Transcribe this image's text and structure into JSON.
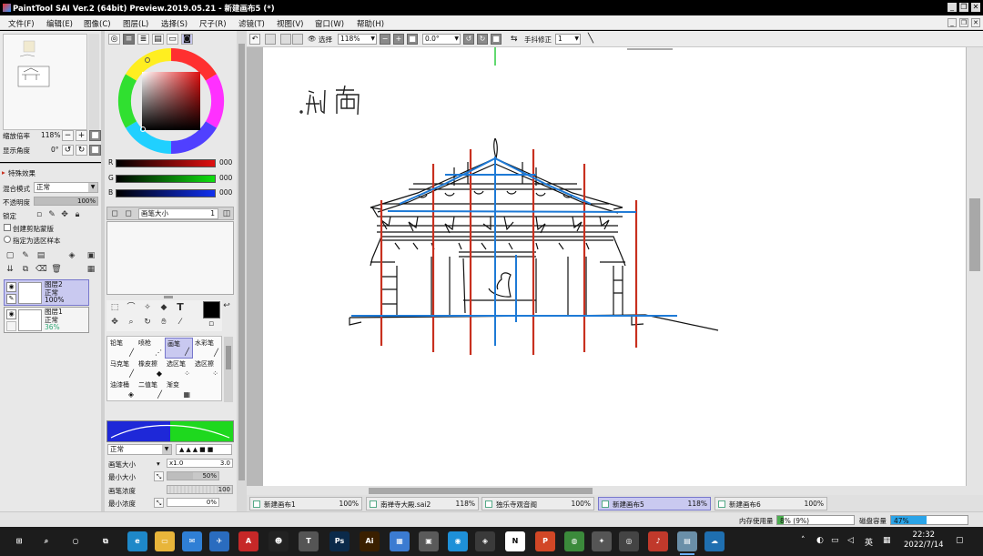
{
  "window": {
    "title": "PaintTool SAI Ver.2 (64bit) Preview.2019.05.21 - 新建画布5 (*)",
    "controls": {
      "minimize": "_",
      "restore": "❐",
      "close": "✕"
    }
  },
  "menu": [
    "文件(F)",
    "编辑(E)",
    "图像(C)",
    "图层(L)",
    "选择(S)",
    "尺子(R)",
    "滤镜(T)",
    "视图(V)",
    "窗口(W)",
    "帮助(H)"
  ],
  "navigator": {
    "zoom_label": "缩放倍率",
    "zoom_value": "118%",
    "angle_label": "显示角度",
    "angle_value": "0°"
  },
  "layer_panel": {
    "effects_label": "特殊效果",
    "blend_label": "混合模式",
    "blend_value": "正常",
    "opacity_label": "不透明度",
    "opacity_value": "100%",
    "opacity_fraction": 1.0,
    "lock_label": "锁定",
    "clip_label": "创建剪贴蒙版",
    "sample_label": "指定为选区样本",
    "layers": [
      {
        "name": "图层2",
        "mode": "正常",
        "opacity": "100%",
        "selected": true
      },
      {
        "name": "图层1",
        "mode": "正常",
        "opacity": "36%",
        "selected": false
      }
    ]
  },
  "color_panel": {
    "r_label": "R",
    "r_value": "000",
    "g_label": "G",
    "g_value": "000",
    "b_label": "B",
    "b_value": "000",
    "brush_size_label": "画笔大小",
    "brush_size_value": "1"
  },
  "brushes": [
    {
      "label": "铅笔",
      "icon": "pencil-icon",
      "selected": false
    },
    {
      "label": "喷枪",
      "icon": "airbrush-icon",
      "selected": false
    },
    {
      "label": "画笔",
      "icon": "brush-icon",
      "selected": true
    },
    {
      "label": "水彩笔",
      "icon": "watercolor-icon",
      "selected": false
    },
    {
      "label": "马克笔",
      "icon": "marker-icon",
      "selected": false
    },
    {
      "label": "橡皮擦",
      "icon": "eraser-icon",
      "selected": false
    },
    {
      "label": "选区笔",
      "icon": "select-pen-icon",
      "selected": false
    },
    {
      "label": "选区擦",
      "icon": "select-eraser-icon",
      "selected": false
    },
    {
      "label": "油漆桶",
      "icon": "bucket-icon",
      "selected": false
    },
    {
      "label": "二值笔",
      "icon": "binary-pen-icon",
      "selected": false
    },
    {
      "label": "渐变",
      "icon": "gradient-icon",
      "selected": false
    },
    {
      "label": "",
      "icon": "",
      "selected": false
    }
  ],
  "brush_settings": {
    "mode_value": "正常",
    "size_label": "画笔大小",
    "size_mult": "x1.0",
    "size_value": "3.0",
    "min_size_label": "最小大小",
    "min_size_value": "50%",
    "min_size_fraction": 0.5,
    "density_label": "画笔浓度",
    "density_value": "100",
    "density_fraction": 1.0,
    "min_density_label": "最小浓度",
    "min_density_value": "0%",
    "min_density_fraction": 0.0
  },
  "canvas_toolbar": {
    "select_label": "选择",
    "zoom_value": "118%",
    "angle_value": "0.0°",
    "stabilizer_label": "手抖修正",
    "stabilizer_value": "1"
  },
  "documents": [
    {
      "name": "新建画布1",
      "zoom": "100%",
      "selected": false
    },
    {
      "name": "南禅寺大殿.sai2",
      "zoom": "118%",
      "selected": false
    },
    {
      "name": "独乐寺观音阁",
      "zoom": "100%",
      "selected": false
    },
    {
      "name": "新建画布5",
      "zoom": "118%",
      "selected": true
    },
    {
      "name": "新建画布6",
      "zoom": "100%",
      "selected": false
    }
  ],
  "status": {
    "memory_label": "内存使用量",
    "memory_value": "8% (9%)",
    "memory_fraction": 0.08,
    "disk_label": "磁盘容量",
    "disk_value": "47%",
    "disk_fraction": 0.47
  },
  "taskbar": {
    "apps": [
      {
        "name": "start-icon",
        "glyph": "⊞",
        "color": "#1c1c1c"
      },
      {
        "name": "search-icon",
        "glyph": "⌕",
        "color": "#1c1c1c"
      },
      {
        "name": "cortana-icon",
        "glyph": "○",
        "color": "#1c1c1c"
      },
      {
        "name": "task-view-icon",
        "glyph": "⧉",
        "color": "#1c1c1c"
      },
      {
        "name": "edge-icon",
        "glyph": "e",
        "color": "#1e88c8"
      },
      {
        "name": "explorer-icon",
        "glyph": "▭",
        "color": "#e8b53a"
      },
      {
        "name": "mail-icon",
        "glyph": "✉",
        "color": "#2f7fd5"
      },
      {
        "name": "maps-icon",
        "glyph": "✈",
        "color": "#2a6cbf"
      },
      {
        "name": "acrobat-icon",
        "glyph": "A",
        "color": "#c62828"
      },
      {
        "name": "qq-icon",
        "glyph": "☻",
        "color": "#222"
      },
      {
        "name": "teamviewer-icon",
        "glyph": "T",
        "color": "#555"
      },
      {
        "name": "photoshop-icon",
        "glyph": "Ps",
        "color": "#0b2a4a"
      },
      {
        "name": "illustrator-icon",
        "glyph": "Ai",
        "color": "#3a1f00"
      },
      {
        "name": "photos-icon",
        "glyph": "▦",
        "color": "#3b7bd1"
      },
      {
        "name": "store-icon",
        "glyph": "▣",
        "color": "#5a5a5a"
      },
      {
        "name": "netease-icon",
        "glyph": "◉",
        "color": "#1e90d8"
      },
      {
        "name": "bilibili-icon",
        "glyph": "◈",
        "color": "#3a3a3a"
      },
      {
        "name": "notion-icon",
        "glyph": "N",
        "color": "#fff"
      },
      {
        "name": "powerpoint-icon",
        "glyph": "P",
        "color": "#d24726"
      },
      {
        "name": "chrome-icon",
        "glyph": "◍",
        "color": "#3b8a3b"
      },
      {
        "name": "rhino-icon",
        "glyph": "✦",
        "color": "#555"
      },
      {
        "name": "screen-record-icon",
        "glyph": "◎",
        "color": "#444"
      },
      {
        "name": "netease-music-icon",
        "glyph": "♪",
        "color": "#c0392b"
      },
      {
        "name": "sai-icon",
        "glyph": "▤",
        "color": "#6a8fa8"
      },
      {
        "name": "weather-icon",
        "glyph": "☁",
        "color": "#1f6fb0"
      }
    ],
    "ime_label": "英",
    "time": "22:32",
    "date": "2022/7/14"
  },
  "colors": {
    "accent_select": "#c9c9f0",
    "memory_fill": "#4caf50",
    "disk_fill": "#2aa4e8",
    "sketch_red": "#c8301f",
    "sketch_blue": "#1e7ad6",
    "sketch_green": "#2ecc40"
  }
}
